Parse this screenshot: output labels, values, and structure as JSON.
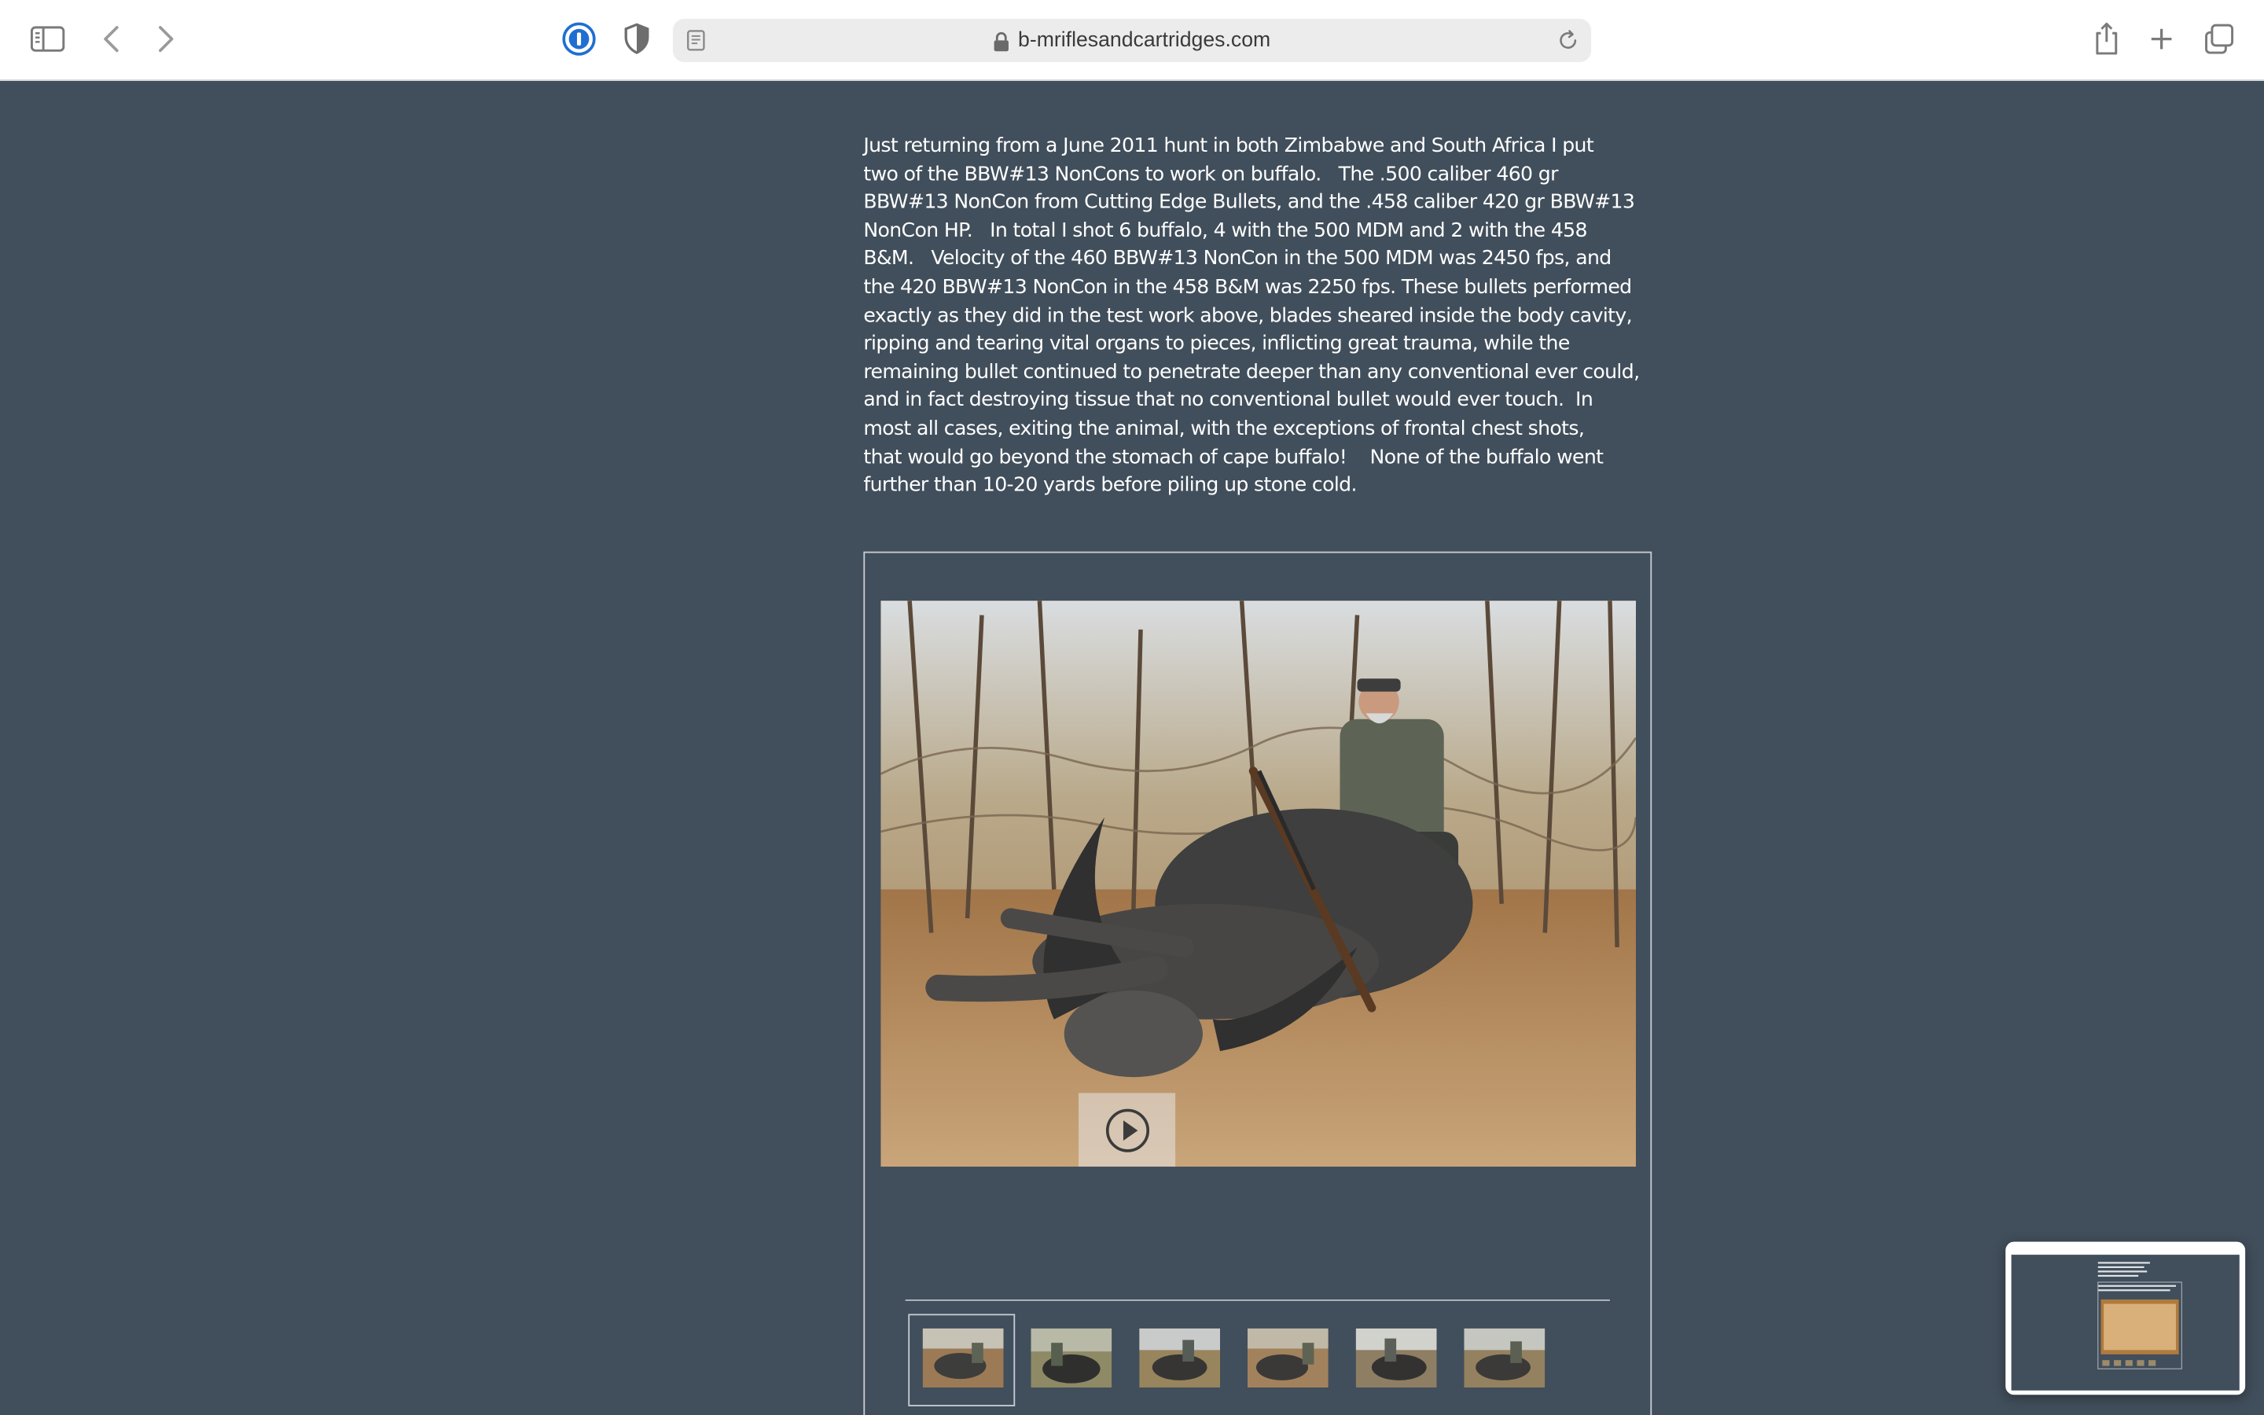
{
  "browser": {
    "url": "b-mriflesandcartridges.com"
  },
  "article": {
    "paragraph": "Just returning from a June 2011 hunt in both Zimbabwe and South Africa I put\ntwo of the BBW#13 NonCons to work on buffalo.   The .500 caliber 460 gr\nBBW#13 NonCon from Cutting Edge Bullets, and the .458 caliber 420 gr BBW#13\nNonCon HP.   In total I shot 6 buffalo, 4 with the 500 MDM and 2 with the 458\nB&M.   Velocity of the 460 BBW#13 NonCon in the 500 MDM was 2450 fps, and\nthe 420 BBW#13 NonCon in the 458 B&M was 2250 fps. These bullets performed\nexactly as they did in the test work above, blades sheared inside the body cavity,\nripping and tearing vital organs to pieces, inflicting great trauma, while the\nremaining bullet continued to penetrate deeper than any conventional ever could,\nand in fact destroying tissue that no conventional bullet would ever touch.  In\nmost all cases, exiting the animal, with the exceptions of frontal chest shots,\nthat would go beyond the stomach of cape buffalo!    None of the buffalo went\nfurther than 10-20 yards before piling up stone cold."
  },
  "gallery": {
    "main_image": "hunter-with-cape-buffalo-and-rifle",
    "thumbnails": [
      {
        "subject": "buffalo-kill-1",
        "selected": true
      },
      {
        "subject": "buffalo-kill-2",
        "selected": false
      },
      {
        "subject": "buffalo-kill-3",
        "selected": false
      },
      {
        "subject": "buffalo-kill-4",
        "selected": false
      },
      {
        "subject": "buffalo-kill-5",
        "selected": false
      },
      {
        "subject": "buffalo-kill-6",
        "selected": false
      }
    ]
  },
  "colors": {
    "page_background": "#414e5b",
    "text": "#ffffff",
    "toolbar_background": "#ffffff",
    "password_icon_blue": "#1f6fd1"
  },
  "icons": {
    "sidebar": "sidebar-icon",
    "back": "chevron-left-icon",
    "forward": "chevron-right-icon",
    "password": "password-manager-icon",
    "privacy": "privacy-shield-icon",
    "reader": "reader-view-icon",
    "lock": "lock-icon",
    "reload": "reload-icon",
    "share": "share-icon",
    "new_tab": "plus-icon",
    "tabs": "tab-overview-icon",
    "play": "play-icon"
  }
}
